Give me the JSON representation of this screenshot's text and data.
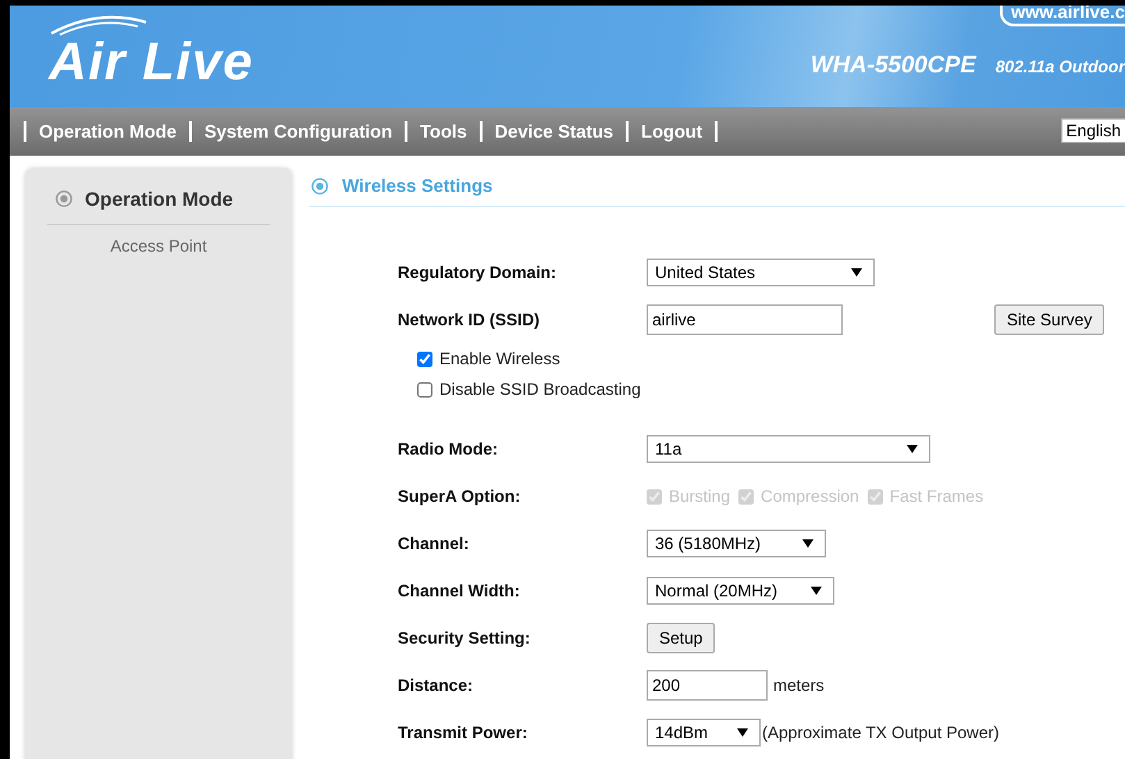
{
  "header": {
    "logo": "Air Live",
    "url": "www.airlive.c",
    "model": "WHA-5500CPE",
    "subtitle": "802.11a Outdoor"
  },
  "nav": {
    "items": [
      {
        "label": "Operation Mode"
      },
      {
        "label": "System Configuration"
      },
      {
        "label": "Tools"
      },
      {
        "label": "Device Status"
      },
      {
        "label": "Logout"
      }
    ],
    "language": "English"
  },
  "sidebar": {
    "title": "Operation Mode",
    "items": [
      {
        "label": "Access Point"
      }
    ]
  },
  "section": {
    "title": "Wireless Settings"
  },
  "rows": [
    {
      "kind": "select",
      "label": "Regulatory Domain:",
      "value": "United States"
    },
    {
      "kind": "input_button",
      "label": "Network ID (SSID)",
      "value": "airlive",
      "button": "Site Survey"
    },
    {
      "kind": "checkbox",
      "label": "Enable Wireless",
      "checked": true
    },
    {
      "kind": "checkbox",
      "label": "Disable SSID Broadcasting",
      "checked": false
    },
    {
      "kind": "select",
      "label": "Radio Mode:",
      "value": "11a"
    },
    {
      "kind": "options",
      "label": "SuperA Option:",
      "options": [
        {
          "label": "Bursting",
          "checked": true,
          "disabled": true
        },
        {
          "label": "Compression",
          "checked": true,
          "disabled": true
        },
        {
          "label": "Fast Frames",
          "checked": true,
          "disabled": true
        }
      ]
    },
    {
      "kind": "select",
      "label": "Channel:",
      "value": "36 (5180MHz)"
    },
    {
      "kind": "select",
      "label": "Channel Width:",
      "value": "Normal (20MHz)"
    },
    {
      "kind": "button",
      "label": "Security Setting:",
      "button": "Setup"
    },
    {
      "kind": "input_unit",
      "label": "Distance:",
      "value": "200",
      "unit": "meters"
    },
    {
      "kind": "select_note",
      "label": "Transmit Power:",
      "value": "14dBm",
      "note": "(Approximate TX Output Power)"
    }
  ]
}
